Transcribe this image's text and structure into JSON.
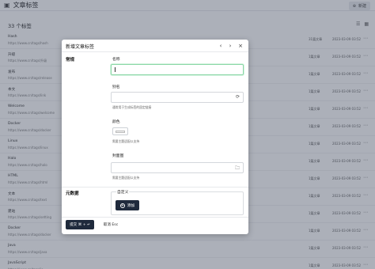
{
  "header": {
    "title": "文章标签",
    "new_label": "新建"
  },
  "count_label": "33 个标签",
  "rows": [
    {
      "name": "Hash",
      "url": "https://www.cn/tags/hash",
      "count": "31篇文章",
      "date": "2023-03-09 03:52"
    },
    {
      "name": "升级",
      "url": "https://www.cn/tags/升级",
      "count": "1篇文章",
      "date": "2023-03-09 03:52"
    },
    {
      "name": "发布",
      "url": "https://www.cn/tags/release",
      "count": "1篇文章",
      "date": "2023-03-09 03:52"
    },
    {
      "name": "本文",
      "url": "https://www.cn/tags/link",
      "count": "1篇文章",
      "date": "2023-03-09 03:52"
    },
    {
      "name": "Welcome",
      "url": "https://www.cn/tags/welcome",
      "count": "1篇文章",
      "date": "2023-03-09 03:52"
    },
    {
      "name": "Docker",
      "url": "https://www.cn/tags/docker",
      "count": "1篇文章",
      "date": "2023-03-09 03:52"
    },
    {
      "name": "Linux",
      "url": "https://www.cn/tags/linux",
      "count": "1篇文章",
      "date": "2023-03-09 03:52"
    },
    {
      "name": "Halo",
      "url": "https://www.cn/tags/halo",
      "count": "1篇文章",
      "date": "2023-03-09 03:52"
    },
    {
      "name": "HTML",
      "url": "https://www.cn/tags/html",
      "count": "1篇文章",
      "date": "2023-03-09 03:52"
    },
    {
      "name": "文本",
      "url": "https://www.cn/tags/text",
      "count": "1篇文章",
      "date": "2023-03-09 03:52"
    },
    {
      "name": "建站",
      "url": "https://www.cn/tags/setting",
      "count": "1篇文章",
      "date": "2023-03-09 03:52"
    },
    {
      "name": "Docker",
      "url": "https://www.cn/tags/docker",
      "count": "1篇文章",
      "date": "2023-03-09 03:52"
    },
    {
      "name": "Java",
      "url": "https://www.cn/tags/java",
      "count": "1篇文章",
      "date": "2023-03-09 03:52"
    },
    {
      "name": "JavaScript",
      "url": "https://www.cn/tags/js",
      "count": "1篇文章",
      "date": "2023-03-09 03:52"
    }
  ],
  "modal": {
    "title": "新增文章标签",
    "section_general": "常规",
    "name_label": "名称",
    "name_value": "",
    "alias_label": "别名",
    "alias_help": "通常用于生成标签的固定链接",
    "color_label": "颜色",
    "color_help": "需要主题适配以支持",
    "cover_label": "封面图",
    "cover_help": "需要主题适配以支持",
    "section_meta": "元数据",
    "custom_label": "自定义",
    "add_label": "添加",
    "submit_label": "提交 ⌘ + ↵",
    "cancel_label": "取消 Esc"
  }
}
